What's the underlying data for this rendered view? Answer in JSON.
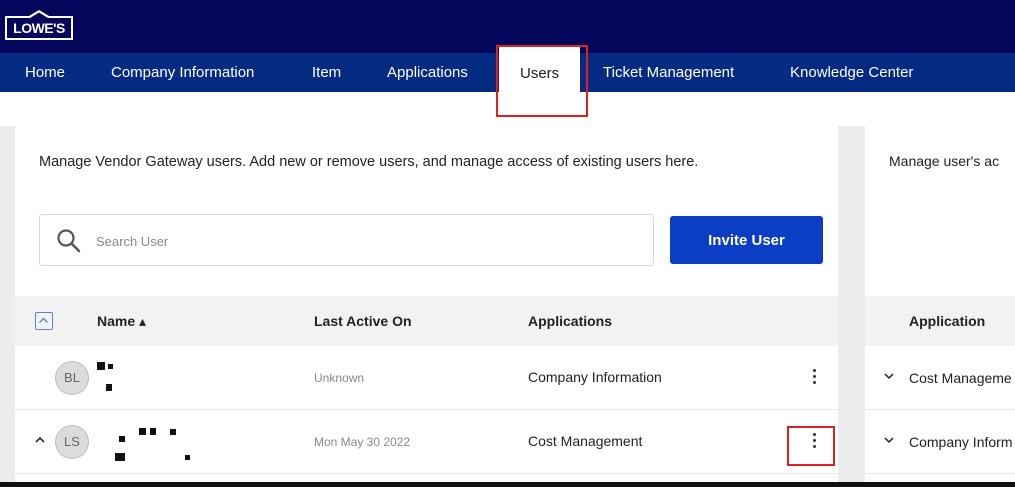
{
  "brand": {
    "logo_text": "LOWE'S",
    "color": "#03065a"
  },
  "nav": {
    "items": [
      {
        "label": "Home"
      },
      {
        "label": "Company Information"
      },
      {
        "label": "Item"
      },
      {
        "label": "Applications"
      },
      {
        "label": "Users",
        "active": true
      },
      {
        "label": "Ticket Management"
      },
      {
        "label": "Knowledge Center"
      }
    ],
    "color": "#052a82"
  },
  "users_panel": {
    "description": "Manage Vendor Gateway users. Add new or remove users, and manage access of existing users here.",
    "search": {
      "placeholder": "Search User",
      "value": ""
    },
    "invite_label": "Invite User",
    "columns": {
      "name": "Name ▴",
      "last_active": "Last Active On",
      "applications": "Applications"
    },
    "rows": [
      {
        "initials": "BL",
        "last_active": "Unknown",
        "application": "Company Information"
      },
      {
        "initials": "LS",
        "last_active": "Mon May 30 2022",
        "application": "Cost Management",
        "expanded": true
      }
    ]
  },
  "right_panel": {
    "description": "Manage user's ac",
    "column": "Application",
    "rows": [
      {
        "label": "Cost Manageme"
      },
      {
        "label": "Company Inform"
      }
    ]
  },
  "accent": {
    "invite_button": "#0b3ec4",
    "highlight": "#e02020"
  }
}
